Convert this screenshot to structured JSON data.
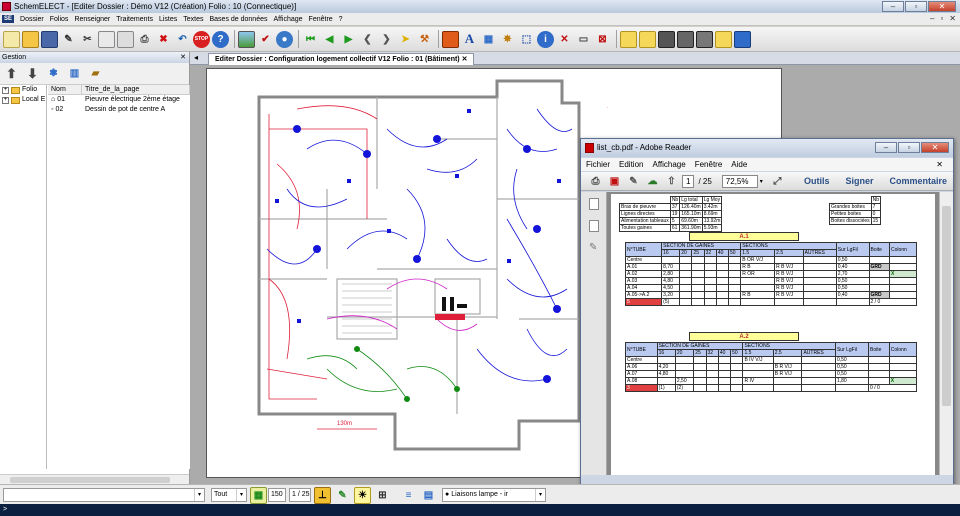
{
  "app": {
    "title": "SchemELECT - [Editer  Dossier : Démo V12  (Création)  Folio : 10  (Connectique)]",
    "menu": [
      "Dossier",
      "Folios",
      "Renseigner",
      "Traitements",
      "Listes",
      "Textes",
      "Bases de données",
      "Affichage",
      "Fenêtre",
      "?"
    ]
  },
  "gestion": {
    "title": "Gestion",
    "tree": [
      "Folio",
      "Local E"
    ],
    "columns": [
      "Nom",
      "Titre_de_la_page"
    ],
    "pages": [
      {
        "nom": "01",
        "titre": "Pieuvre électrique 2ème étage"
      },
      {
        "nom": "02",
        "titre": "Dessin de pot de centre A"
      }
    ]
  },
  "document": {
    "tab_title": "Editer  Dossier : Configuration logement collectif V12  Folio : 01  (Bâtiment)",
    "dimension_label": "130m"
  },
  "bottom": {
    "mode": "Tout",
    "zoom": "150",
    "page_index": "1 / 25",
    "layer": "Liaisons lampe - ir",
    "status": ">"
  },
  "adobe": {
    "title": "list_cb.pdf - Adobe Reader",
    "menu": [
      "Fichier",
      "Edition",
      "Affichage",
      "Fenêtre",
      "Aide"
    ],
    "page_current": "1",
    "page_total": "/ 25",
    "zoom": "72,5%",
    "links": [
      "Outils",
      "Signer",
      "Commentaire"
    ],
    "summary": {
      "headers": [
        "Nb",
        "Lg total",
        "Lg Moy"
      ],
      "rows": [
        [
          "Bras de pieuvre",
          "37",
          "126.40m",
          "3.42m"
        ],
        [
          "Lignes directes",
          "19",
          "165.10m",
          "8.69m"
        ],
        [
          "Alimentation tableaux",
          "5",
          "69.60m",
          "13.92m"
        ],
        [
          "Toutes gaines",
          "61",
          "361.90m",
          "5.93m"
        ]
      ]
    },
    "boxes": {
      "header": "Nb",
      "rows": [
        [
          "Grandes boites",
          "7"
        ],
        [
          "Petites boites",
          "0"
        ],
        [
          "Boites dissociées",
          "15"
        ]
      ]
    },
    "sections": [
      {
        "name": "A.1",
        "rows": [
          [
            "Centre",
            "",
            "",
            "B OR V/J",
            "",
            "0,50",
            ""
          ],
          [
            "A.01",
            "8,70",
            "",
            "R B",
            "R B V/J",
            "0,40",
            "GRD"
          ],
          [
            "A.02",
            "2,80",
            "",
            "R OR",
            "R B V/J",
            "2,70",
            "X"
          ],
          [
            "A.03",
            "4,80",
            "",
            "",
            "R B V/J",
            "0,50",
            ""
          ],
          [
            "A.04",
            "4,50",
            "",
            "",
            "R B V/J",
            "0,50",
            ""
          ],
          [
            "A.05->A.2",
            "3,20",
            "",
            "R B",
            "R B V/J",
            "0,40",
            "GRD"
          ]
        ],
        "footer": [
          "5",
          "(5)",
          "2 / 0"
        ]
      },
      {
        "name": "A.2",
        "rows": [
          [
            "Centre",
            "",
            "",
            "B IV V/J",
            "",
            "0,50",
            ""
          ],
          [
            "A.06",
            "4,20",
            "",
            "",
            "B R V/J",
            "0,50",
            ""
          ],
          [
            "A.07",
            "4,80",
            "",
            "",
            "B R V/J",
            "0,50",
            ""
          ],
          [
            "A.08",
            "",
            "2,50",
            "R IV",
            "",
            "1,80",
            "X"
          ]
        ],
        "footer": [
          "3",
          "(1)",
          "(2)",
          "0 / 0"
        ]
      }
    ],
    "table_headers": {
      "tube": "N°TUBE",
      "gaines": "SECTION DE GAINES",
      "gaines_sizes": [
        "16",
        "20",
        "25",
        "32",
        "40",
        "50"
      ],
      "sections": "SECTIONS",
      "section_sizes": [
        "1.5",
        "2.5",
        "AUTRES"
      ],
      "sur": "Sur LgFil",
      "boite": "Boite",
      "colonne": "Colonn"
    }
  },
  "colors": {
    "accent": "#2b4f86",
    "plan_blue": "#1414d8",
    "plan_red": "#e0203a",
    "plan_green": "#108a10",
    "plan_magenta": "#d020c8"
  }
}
